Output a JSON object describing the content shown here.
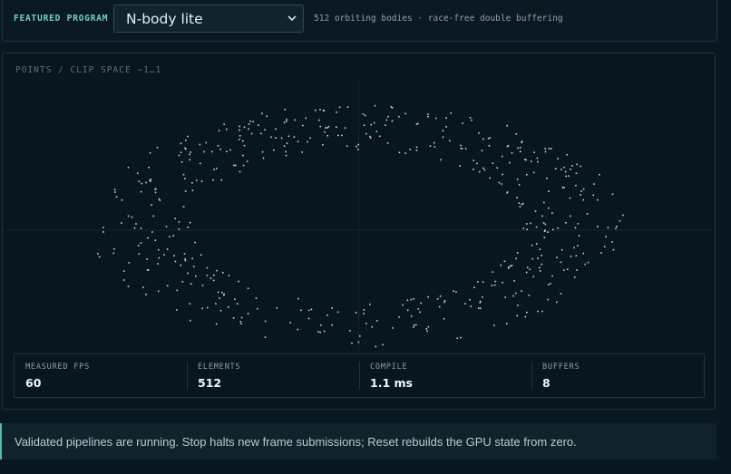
{
  "header": {
    "featured_label": "FEATURED PROGRAM",
    "program": {
      "selected": "N-body lite",
      "icon": "chevron-down-icon"
    },
    "description": "512 orbiting bodies · race-free double buffering"
  },
  "canvas": {
    "label": "POINTS / CLIP SPACE −1…1",
    "point_color": "#c9d6da",
    "grid_color": "#13262f"
  },
  "stats": [
    {
      "label": "MEASURED FPS",
      "value": "60"
    },
    {
      "label": "ELEMENTS",
      "value": "512"
    },
    {
      "label": "COMPILE",
      "value": "1.1 ms"
    },
    {
      "label": "BUFFERS",
      "value": "8"
    }
  ],
  "banner": {
    "text": "Validated pipelines are running. Stop halts new frame submissions; Reset rebuilds the GPU state from zero.",
    "accent": "#5fb8b0"
  },
  "colors": {
    "background": "#091820",
    "accent": "#6fd0c2"
  }
}
